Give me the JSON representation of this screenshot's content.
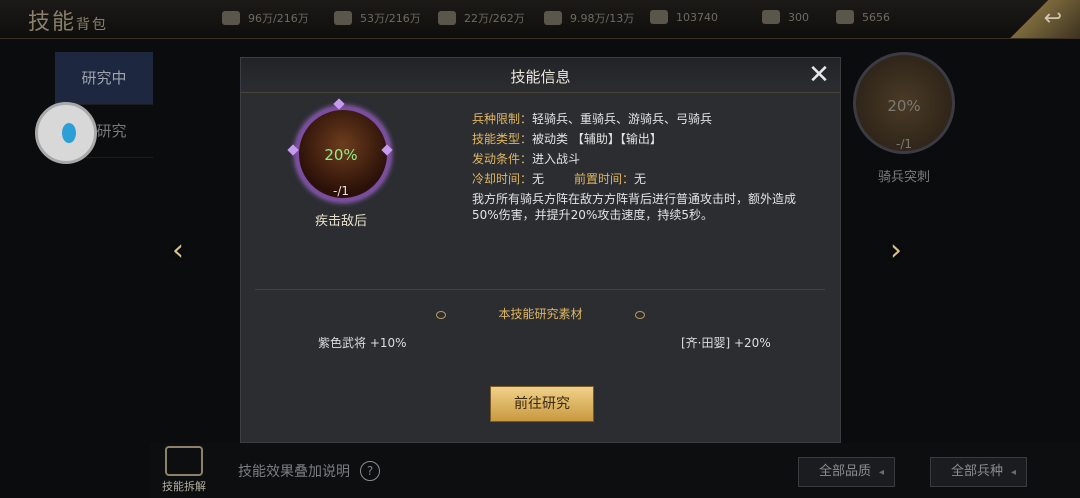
{
  "header": {
    "title_main": "技能",
    "title_sub": "背包",
    "resources": [
      {
        "icon": "wheat-icon",
        "value": "96万/216万"
      },
      {
        "icon": "wood-icon",
        "value": "53万/216万"
      },
      {
        "icon": "stone-icon",
        "value": "22万/262万"
      },
      {
        "icon": "iron-icon",
        "value": "9.98万/13万"
      },
      {
        "icon": "troop-icon",
        "value": "103740"
      },
      {
        "icon": "crown-icon",
        "value": "300"
      },
      {
        "icon": "gold-icon",
        "value": "5656"
      }
    ]
  },
  "sidebar": {
    "tabs": [
      {
        "label": "研究中",
        "active": true
      },
      {
        "label": "已研究",
        "active": false
      }
    ]
  },
  "background_card": {
    "percent": "20%",
    "count": "-/1",
    "name": "骑兵突刺"
  },
  "bottom": {
    "decompose_label": "技能拆解",
    "effect_note": "技能效果叠加说明",
    "help_symbol": "?",
    "filter_quality": "全部品质",
    "filter_type": "全部兵种"
  },
  "modal": {
    "title": "技能信息",
    "skill": {
      "percent": "20%",
      "count": "-/1",
      "name": "疾击敌后"
    },
    "info": {
      "troop_label": "兵种限制：",
      "troop_value": "轻骑兵、重骑兵、游骑兵、弓骑兵",
      "type_label": "技能类型：",
      "type_value": "被动类 【辅助】【输出】",
      "trigger_label": "发动条件：",
      "trigger_value": "进入战斗",
      "cooldown_label": "冷却时间：",
      "cooldown_value": "无",
      "precast_label": "前置时间：",
      "precast_value": "无",
      "description": "我方所有骑兵方阵在敌方方阵背后进行普通攻击时，额外造成50%伤害，并提升20%攻击速度，持续5秒。"
    },
    "materials": {
      "title": "本技能研究素材",
      "left": "紫色武将 +10%",
      "right": "[齐·田婴] +20%"
    },
    "go_button": "前往研究"
  },
  "colors": {
    "accent_gold": "#e0b661",
    "percent_green": "#8ff08a",
    "button_gold": "#f0d189"
  }
}
